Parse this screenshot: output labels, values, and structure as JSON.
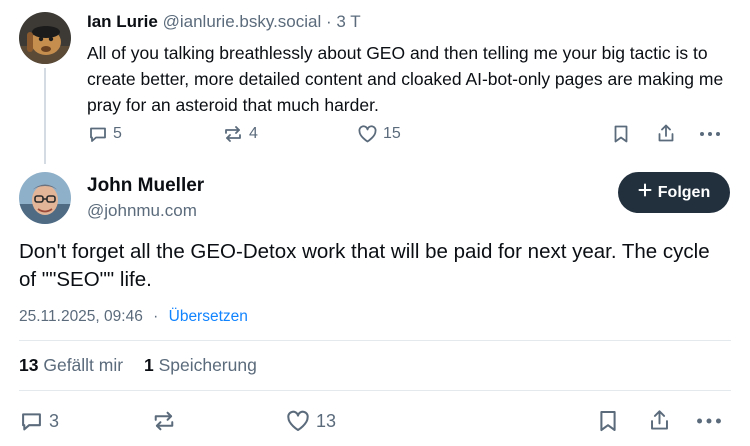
{
  "parent": {
    "author_name": "Ian Lurie",
    "author_handle": "@ianlurie.bsky.social",
    "separator": "·",
    "time": "3 T",
    "text": "All of you talking breathlessly about GEO and then telling me your big tactic is to create better, more detailed content and cloaked AI-bot-only pages are making me pray for an asteroid that much harder.",
    "replies": "5",
    "reposts": "4",
    "likes": "15"
  },
  "post": {
    "author_name": "John Mueller",
    "author_handle": "@johnmu.com",
    "follow_label": "Folgen",
    "text": "Don't forget all the GEO-Detox work that will be paid for next year. The cycle of \"\"SEO\"\" life.",
    "timestamp": "25.11.2025, 09:46",
    "separator": "·",
    "translate_label": "Übersetzen",
    "likes_count": "13",
    "likes_label": "Gefällt mir",
    "saves_count": "1",
    "saves_label": "Speicherung",
    "replies": "3",
    "likes": "13"
  },
  "colors": {
    "text": "#0b0f14",
    "muted": "#5b6b7c",
    "link": "#1083fe",
    "button": "#22303e",
    "divider": "#e4e9ee",
    "thread_line": "#d4dbe2"
  },
  "icons": [
    "reply-icon",
    "repost-icon",
    "like-icon",
    "bookmark-icon",
    "share-icon",
    "more-icon",
    "plus-icon"
  ]
}
